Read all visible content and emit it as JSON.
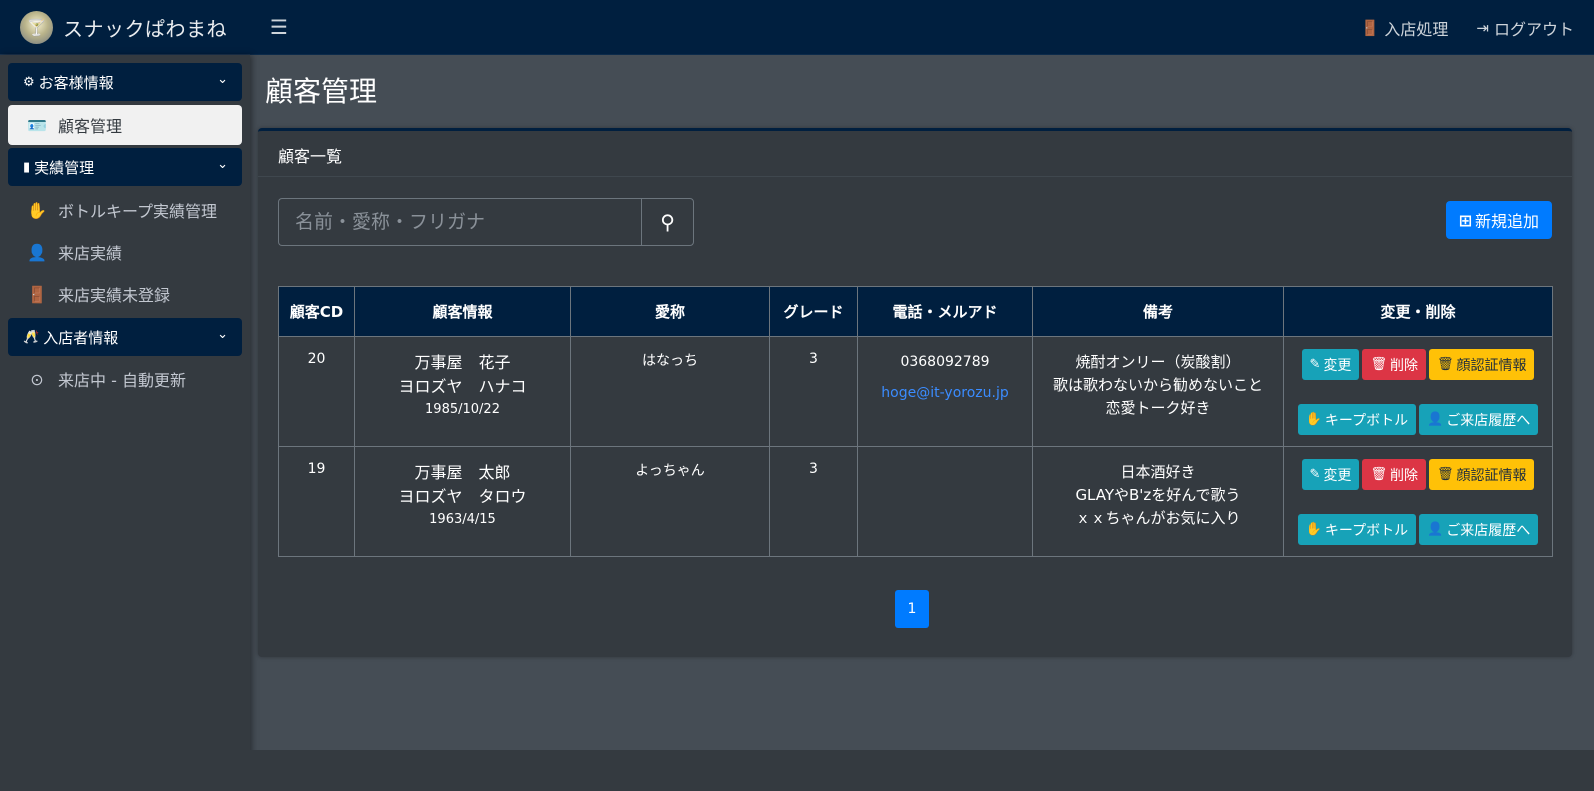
{
  "brand": {
    "name": "スナックぱわまね",
    "logo_icon": "logo-glass-icon"
  },
  "topbar": {
    "menu_icon": "hamburger-icon",
    "links": [
      {
        "label": "入店処理",
        "icon": "door-icon"
      },
      {
        "label": "ログアウト",
        "icon": "sign-out-icon"
      }
    ]
  },
  "sidebar": {
    "sections": [
      {
        "label": "お客様情報",
        "icon": "gear-icon"
      },
      {
        "label": "実績管理",
        "icon": "chart-icon"
      },
      {
        "label": "入店者情報",
        "icon": "glass-icon"
      }
    ],
    "items": [
      {
        "label": "顧客管理",
        "icon": "id-card-icon",
        "active": true
      },
      {
        "label": "ボトルキープ実績管理",
        "icon": "hand-icon"
      },
      {
        "label": "来店実績",
        "icon": "user-clock-icon"
      },
      {
        "label": "来店実績未登録",
        "icon": "door-icon"
      },
      {
        "label": "来店中 - 自動更新",
        "icon": "binoculars-icon"
      }
    ]
  },
  "main": {
    "title": "顧客管理",
    "card_title": "顧客一覧",
    "search": {
      "placeholder": "名前・愛称・フリガナ"
    },
    "add_button": "新規追加",
    "table": {
      "headers": [
        "顧客CD",
        "顧客情報",
        "愛称",
        "グレード",
        "電話・メルアド",
        "備考",
        "変更・削除"
      ],
      "rows": [
        {
          "cd": "20",
          "name": "万事屋　花子",
          "kana": "ヨロズヤ　ハナコ",
          "birthday": "1985/10/22",
          "nickname": "はなっち",
          "grade": "3",
          "phone": "0368092789",
          "email": "hoge@it-yorozu.jp",
          "remarks": [
            "焼酎オンリー（炭酸割）",
            "歌は歌わないから勧めないこと",
            "恋愛トーク好き"
          ]
        },
        {
          "cd": "19",
          "name": "万事屋　太郎",
          "kana": "ヨロズヤ　タロウ",
          "birthday": "1963/4/15",
          "nickname": "よっちゃん",
          "grade": "3",
          "phone": "",
          "email": "",
          "remarks": [
            "日本酒好き",
            "GLAYやB'zを好んで歌う",
            "ｘｘちゃんがお気に入り"
          ]
        }
      ],
      "actions": {
        "edit": "変更",
        "delete": "削除",
        "face": "顔認証情報",
        "keep": "キープボトル",
        "history": "ご来店履歴へ"
      }
    },
    "pagination": {
      "current": "1"
    }
  },
  "colors": {
    "navbar": "#001f3f",
    "sidebar": "#343a40",
    "content_bg": "#454d55",
    "primary": "#007bff",
    "info": "#17a2b8",
    "danger": "#dc3545",
    "warning": "#ffc107"
  }
}
